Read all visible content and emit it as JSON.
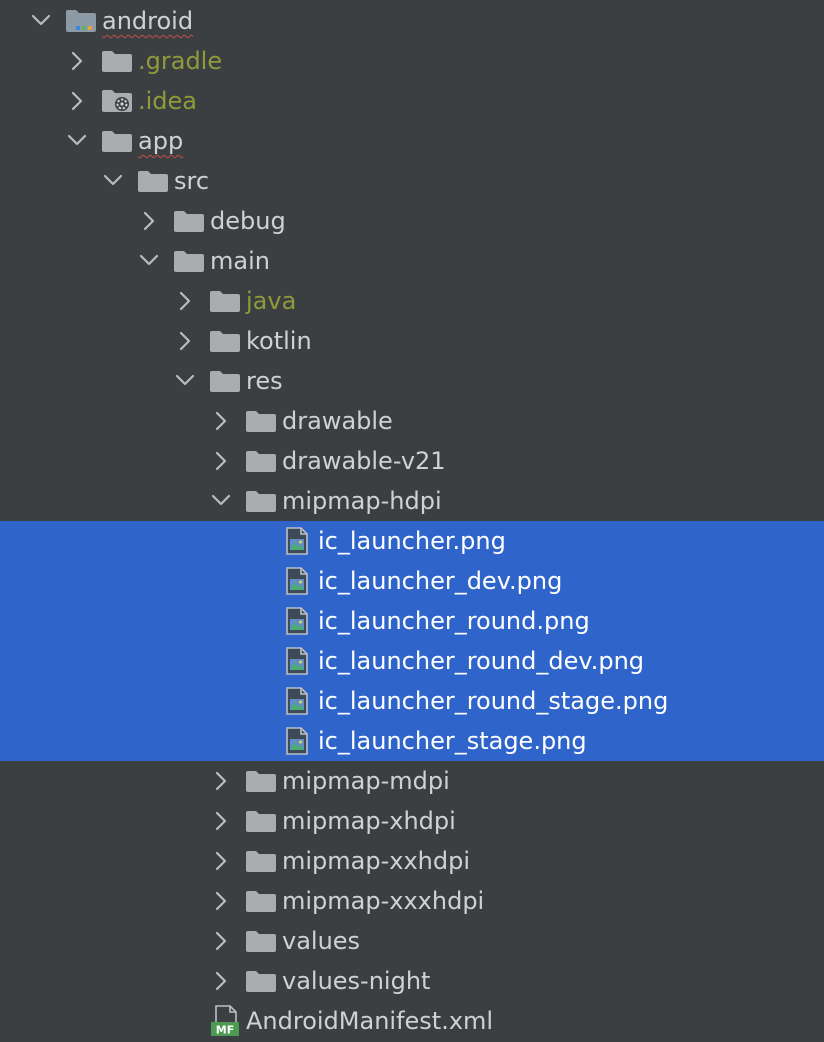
{
  "colors": {
    "background": "#3c3f41",
    "selection": "#2f65ca",
    "text": "#cfd2d4",
    "excluded_text": "#8f9a3c",
    "folder_icon": "#a9adb0",
    "spell_underline": "#c74b4b"
  },
  "tree": [
    {
      "label": "android",
      "depth": 0,
      "state": "expanded",
      "icon": "module-folder-icon",
      "style": "spell",
      "selected": false
    },
    {
      "label": ".gradle",
      "depth": 1,
      "state": "collapsed",
      "icon": "folder-icon",
      "style": "excluded",
      "selected": false
    },
    {
      "label": ".idea",
      "depth": 1,
      "state": "collapsed",
      "icon": "idea-folder-icon",
      "style": "excluded",
      "selected": false
    },
    {
      "label": "app",
      "depth": 1,
      "state": "expanded",
      "icon": "folder-icon",
      "style": "spell",
      "selected": false
    },
    {
      "label": "src",
      "depth": 2,
      "state": "expanded",
      "icon": "folder-icon",
      "style": "normal",
      "selected": false
    },
    {
      "label": "debug",
      "depth": 3,
      "state": "collapsed",
      "icon": "folder-icon",
      "style": "normal",
      "selected": false
    },
    {
      "label": "main",
      "depth": 3,
      "state": "expanded",
      "icon": "folder-icon",
      "style": "normal",
      "selected": false
    },
    {
      "label": "java",
      "depth": 4,
      "state": "collapsed",
      "icon": "folder-icon",
      "style": "excluded",
      "selected": false
    },
    {
      "label": "kotlin",
      "depth": 4,
      "state": "collapsed",
      "icon": "folder-icon",
      "style": "normal",
      "selected": false
    },
    {
      "label": "res",
      "depth": 4,
      "state": "expanded",
      "icon": "folder-icon",
      "style": "normal",
      "selected": false
    },
    {
      "label": "drawable",
      "depth": 5,
      "state": "collapsed",
      "icon": "folder-icon",
      "style": "normal",
      "selected": false
    },
    {
      "label": "drawable-v21",
      "depth": 5,
      "state": "collapsed",
      "icon": "folder-icon",
      "style": "normal",
      "selected": false
    },
    {
      "label": "mipmap-hdpi",
      "depth": 5,
      "state": "expanded",
      "icon": "folder-icon",
      "style": "normal",
      "selected": false
    },
    {
      "label": "ic_launcher.png",
      "depth": 6,
      "state": "leaf",
      "icon": "image-file-icon",
      "style": "normal",
      "selected": true
    },
    {
      "label": "ic_launcher_dev.png",
      "depth": 6,
      "state": "leaf",
      "icon": "image-file-icon",
      "style": "normal",
      "selected": true
    },
    {
      "label": "ic_launcher_round.png",
      "depth": 6,
      "state": "leaf",
      "icon": "image-file-icon",
      "style": "normal",
      "selected": true
    },
    {
      "label": "ic_launcher_round_dev.png",
      "depth": 6,
      "state": "leaf",
      "icon": "image-file-icon",
      "style": "normal",
      "selected": true
    },
    {
      "label": "ic_launcher_round_stage.png",
      "depth": 6,
      "state": "leaf",
      "icon": "image-file-icon",
      "style": "normal",
      "selected": true
    },
    {
      "label": "ic_launcher_stage.png",
      "depth": 6,
      "state": "leaf",
      "icon": "image-file-icon",
      "style": "normal",
      "selected": true
    },
    {
      "label": "mipmap-mdpi",
      "depth": 5,
      "state": "collapsed",
      "icon": "folder-icon",
      "style": "normal",
      "selected": false
    },
    {
      "label": "mipmap-xhdpi",
      "depth": 5,
      "state": "collapsed",
      "icon": "folder-icon",
      "style": "normal",
      "selected": false
    },
    {
      "label": "mipmap-xxhdpi",
      "depth": 5,
      "state": "collapsed",
      "icon": "folder-icon",
      "style": "normal",
      "selected": false
    },
    {
      "label": "mipmap-xxxhdpi",
      "depth": 5,
      "state": "collapsed",
      "icon": "folder-icon",
      "style": "normal",
      "selected": false
    },
    {
      "label": "values",
      "depth": 5,
      "state": "collapsed",
      "icon": "folder-icon",
      "style": "normal",
      "selected": false
    },
    {
      "label": "values-night",
      "depth": 5,
      "state": "collapsed",
      "icon": "folder-icon",
      "style": "normal",
      "selected": false
    },
    {
      "label": "AndroidManifest.xml",
      "depth": 4,
      "state": "leaf",
      "icon": "manifest-file-icon",
      "style": "normal",
      "selected": false
    }
  ]
}
